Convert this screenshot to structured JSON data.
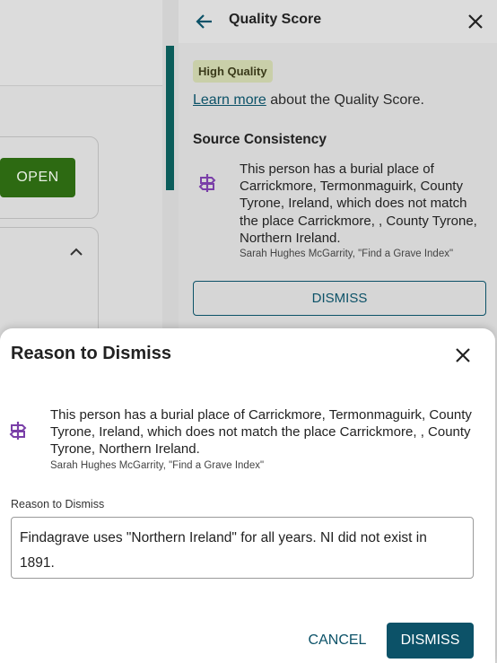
{
  "background": {
    "open_button_label": "OPEN"
  },
  "quality_panel": {
    "title": "Quality Score",
    "badge": "High Quality",
    "learn_more_link": "Learn more",
    "learn_more_suffix": " about the Quality Score.",
    "section_title": "Source Consistency",
    "message": "This person has a burial place of Carrickmore, Termonmaguirk, County Tyrone, Ireland, which does not match the place Carrickmore, , County Tyrone, Northern Ireland.",
    "citation": "Sarah Hughes McGarrity, \"Find a Grave Index\"",
    "dismiss_label": "DISMISS"
  },
  "dialog": {
    "title": "Reason to Dismiss",
    "message": "This person has a burial place of Carrickmore, Termonmaguirk, County Tyrone, Ireland, which does not match the place Carrickmore, , County Tyrone, Northern Ireland.",
    "citation": "Sarah Hughes McGarrity, \"Find a Grave Index\"",
    "field_label": "Reason to Dismiss",
    "field_value": "Findagrave uses \"Northern Ireland\" for all years. NI did not exist in 1891.",
    "cancel_label": "CANCEL",
    "dismiss_label": "DISMISS"
  },
  "colors": {
    "brand_teal": "#0c5268",
    "open_green": "#2d6a12",
    "accent_bar": "#0b5d5b",
    "sign_icon": "#7a3fa8",
    "badge_bg": "#c9cfa9"
  },
  "icons": {
    "back": "arrow-left-icon",
    "close": "close-icon",
    "sign": "signpost-icon",
    "chevron": "chevron-up-icon"
  }
}
